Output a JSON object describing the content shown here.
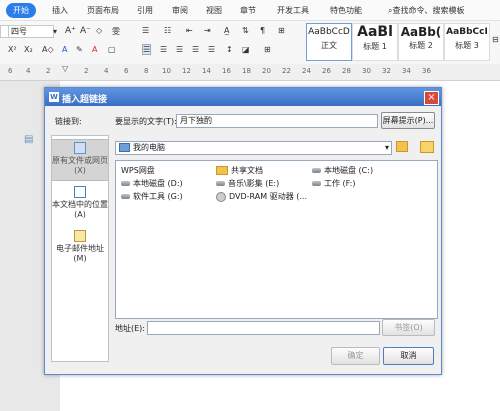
{
  "menubar": {
    "items": [
      "开始",
      "插入",
      "页面布局",
      "引用",
      "审阅",
      "视图",
      "章节",
      "开发工具",
      "特色功能"
    ],
    "search": "查找命令、搜索模板"
  },
  "toolbar": {
    "font_size": "四号",
    "styles": [
      {
        "preview": "AaBbCcD",
        "name": "正文"
      },
      {
        "preview": "AaBl",
        "name": "标题 1"
      },
      {
        "preview": "AaBb(",
        "name": "标题 2"
      },
      {
        "preview": "AaBbCcI",
        "name": "标题 3"
      }
    ]
  },
  "ruler": {
    "numbers": [
      "6",
      "4",
      "2",
      "2",
      "4",
      "6",
      "8",
      "10",
      "12",
      "14",
      "16",
      "18",
      "20",
      "22",
      "24",
      "26",
      "28",
      "30",
      "32",
      "34",
      "36"
    ]
  },
  "dialog": {
    "title": "插入超链接",
    "link_to_label": "链接到:",
    "display_text_label": "要显示的文字(T):",
    "display_text_value": "月下独酌",
    "screen_tip_button": "屏幕提示(P)...",
    "location_value": "我的电脑",
    "link_options": [
      {
        "label": "原有文件或网页(X)",
        "icon": "globe-page-icon"
      },
      {
        "label": "本文档中的位置(A)",
        "icon": "document-icon"
      },
      {
        "label": "电子邮件地址(M)",
        "icon": "mail-icon"
      }
    ],
    "files": [
      {
        "name": "WPS网盘",
        "icon": "none"
      },
      {
        "name": "共享文档",
        "icon": "folder-icon"
      },
      {
        "name": "本地磁盘 (C:)",
        "icon": "disk-icon"
      },
      {
        "name": "本地磁盘 (D:)",
        "icon": "disk-icon"
      },
      {
        "name": "音乐\\影集 (E:)",
        "icon": "disk-icon"
      },
      {
        "name": "工作 (F:)",
        "icon": "disk-icon"
      },
      {
        "name": "软件工具 (G:)",
        "icon": "disk-icon"
      },
      {
        "name": "DVD-RAM 驱动器 (...",
        "icon": "dvd-icon"
      }
    ],
    "address_label": "地址(E):",
    "address_value": "",
    "bookmark_button": "书签(O)",
    "ok_button": "确定",
    "cancel_button": "取消"
  }
}
